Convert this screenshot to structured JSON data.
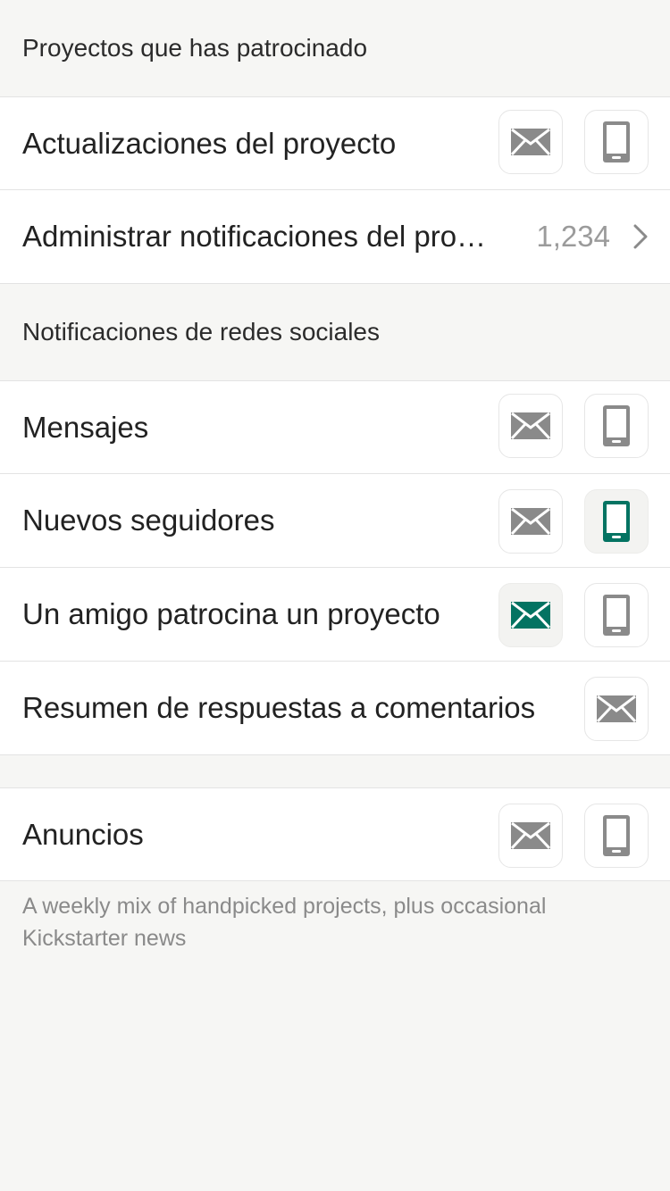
{
  "colors": {
    "background": "#f6f6f4",
    "row_background": "#ffffff",
    "icon_off": "#8a8a8a",
    "icon_on": "#037362"
  },
  "sections": {
    "backed_projects_header": "Proyectos que has patrocinado",
    "social_header": "Notificaciones de redes sociales"
  },
  "rows": {
    "project_updates": {
      "label": "Actualizaciones del proyecto",
      "email_on": false,
      "phone_on": false
    },
    "manage_project_notifications": {
      "label": "Administrar notificaciones del pro…",
      "count": "1,234"
    },
    "messages": {
      "label": "Mensajes",
      "email_on": false,
      "phone_on": false
    },
    "new_followers": {
      "label": "Nuevos seguidores",
      "email_on": false,
      "phone_on": true
    },
    "friend_backs": {
      "label": "Un amigo patrocina un proyecto",
      "email_on": true,
      "phone_on": false
    },
    "comment_replies": {
      "label": "Resumen de respuestas a comentarios",
      "email_on": false
    },
    "announcements": {
      "label": "Anuncios",
      "email_on": false,
      "phone_on": false
    }
  },
  "footer_note": "A weekly mix of handpicked projects, plus occasional Kickstarter news",
  "icons": {
    "email": "envelope-icon",
    "phone": "phone-icon",
    "chevron": "chevron-right-icon"
  }
}
